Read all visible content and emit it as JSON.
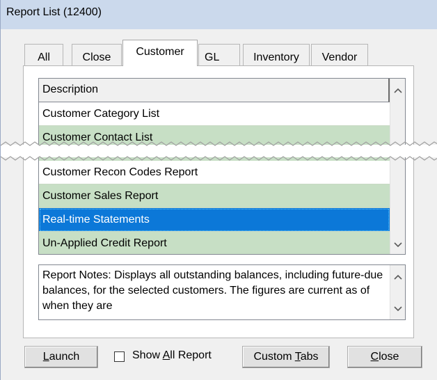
{
  "window": {
    "title": "Report List (12400)"
  },
  "tabs": [
    {
      "label": "All",
      "active": false
    },
    {
      "label": "Close",
      "active": false
    },
    {
      "label": "Customer",
      "active": true
    },
    {
      "label": "GL",
      "active": false
    },
    {
      "label": "Inventory",
      "active": false
    },
    {
      "label": "Vendor",
      "active": false
    }
  ],
  "list": {
    "header": "Description",
    "rows_top": [
      {
        "label": "Customer Category List",
        "style": "white"
      },
      {
        "label": "Customer Contact List",
        "style": "green"
      }
    ],
    "rows_bottom": [
      {
        "label": "Customer Recon Codes Report",
        "style": "white"
      },
      {
        "label": "Customer Sales Report",
        "style": "green"
      },
      {
        "label": "Real-time Statements",
        "style": "selected"
      },
      {
        "label": "Un-Applied Credit Report",
        "style": "green"
      }
    ]
  },
  "notes": {
    "text": "Report Notes:  Displays all outstanding balances, including future-due balances, for the selected customers. The figures are current as of when they are"
  },
  "buttons": {
    "launch_pre": "",
    "launch_u": "L",
    "launch_post": "aunch",
    "show_all_pre": "Show ",
    "show_all_u": "A",
    "show_all_post": "ll Report",
    "custom_tabs_pre": "Custom ",
    "custom_tabs_u": "T",
    "custom_tabs_post": "abs",
    "close_pre": "",
    "close_u": "C",
    "close_post": "lose"
  },
  "icons": {
    "scroll_up": "chevron-up-icon",
    "scroll_down": "chevron-down-icon"
  },
  "colors": {
    "selection": "#0c78d8",
    "alt_row": "#c7dfc5",
    "titlebar": "#cbd9ec"
  }
}
